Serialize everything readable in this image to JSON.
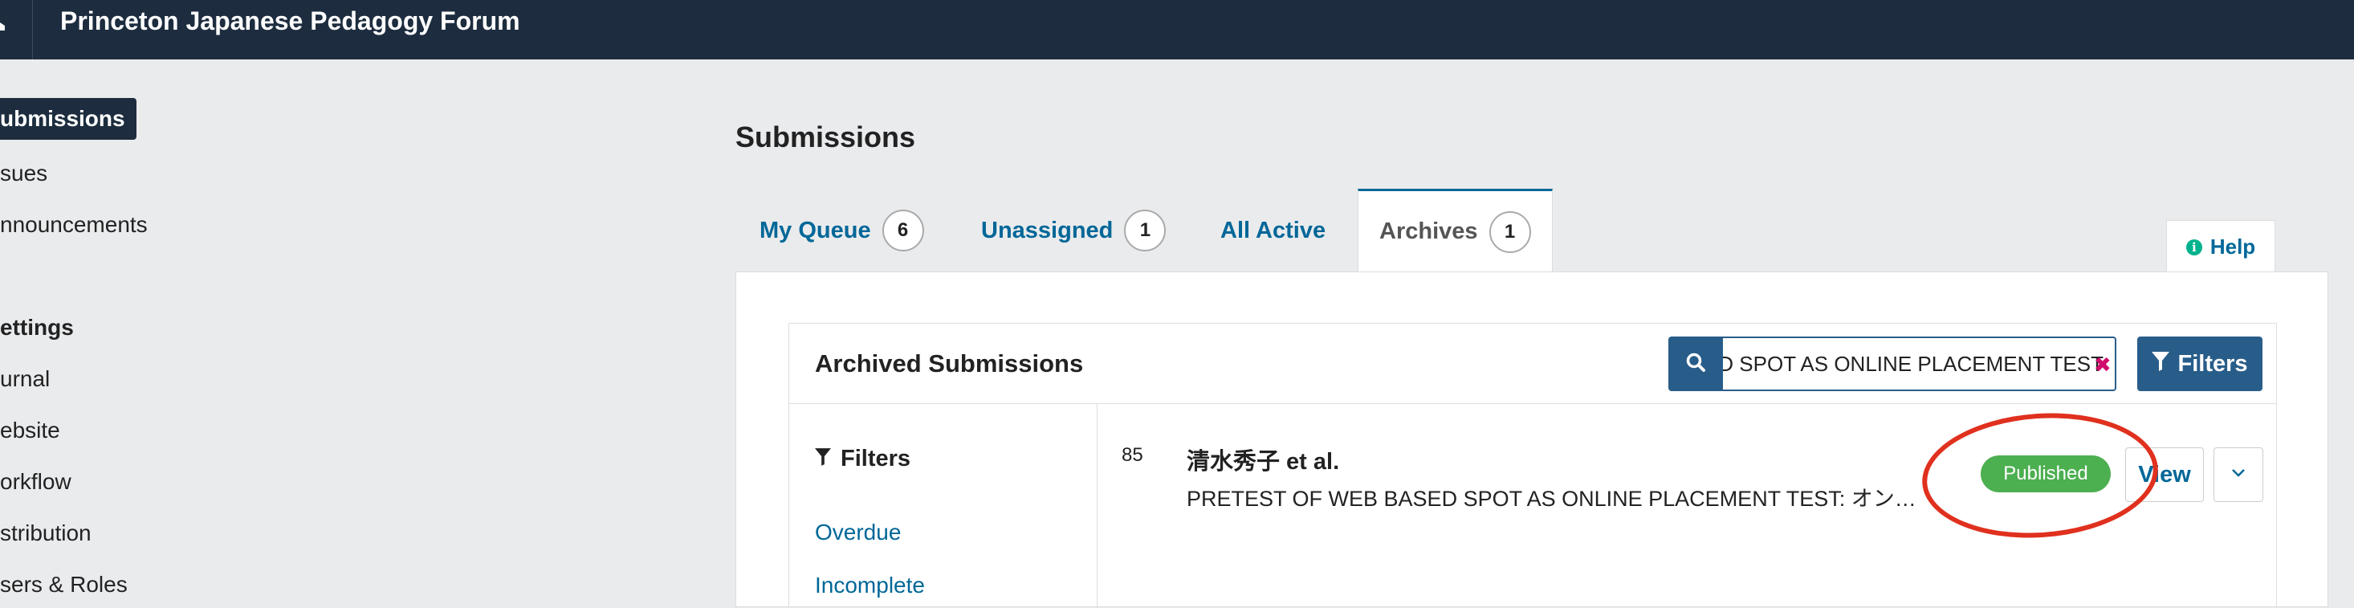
{
  "header": {
    "site_title": "Princeton Japanese Pedagogy Forum"
  },
  "sidebar": {
    "items": [
      {
        "label": "ubmissions",
        "active": true
      },
      {
        "label": "sues"
      },
      {
        "label": "nnouncements"
      }
    ],
    "settings_heading": "ettings",
    "settings_items": [
      {
        "label": "urnal"
      },
      {
        "label": "ebsite"
      },
      {
        "label": "orkflow"
      },
      {
        "label": "stribution"
      },
      {
        "label": "sers & Roles"
      }
    ]
  },
  "main": {
    "page_title": "Submissions",
    "tabs": [
      {
        "label": "My Queue",
        "count": "6"
      },
      {
        "label": "Unassigned",
        "count": "1"
      },
      {
        "label": "All Active"
      },
      {
        "label": "Archives",
        "count": "1",
        "active": true
      }
    ],
    "help_label": "Help"
  },
  "list_panel": {
    "title": "Archived Submissions",
    "search_value": "PRETEST OF WEB BASED SPOT AS ONLINE PLACEMENT TEST",
    "filters_button": "Filters",
    "filters_heading": "Filters",
    "filter_links": [
      "Overdue",
      "Incomplete"
    ],
    "submissions": [
      {
        "id": "85",
        "author": "清水秀子 et al.",
        "title": "PRETEST OF WEB BASED SPOT AS ONLINE PLACEMENT TEST: オンライ...",
        "status": "Published",
        "view_label": "View"
      }
    ]
  },
  "colors": {
    "header_bg": "#1d2d3f",
    "accent": "#006798",
    "button_bg": "#285d8a",
    "published": "#4caf50",
    "annotation": "#e0301e"
  },
  "icons": {
    "home": "home-icon",
    "search": "search-icon",
    "filter": "filter-icon",
    "clear": "clear-icon",
    "info": "info-icon",
    "chevron": "chevron-down-icon"
  }
}
